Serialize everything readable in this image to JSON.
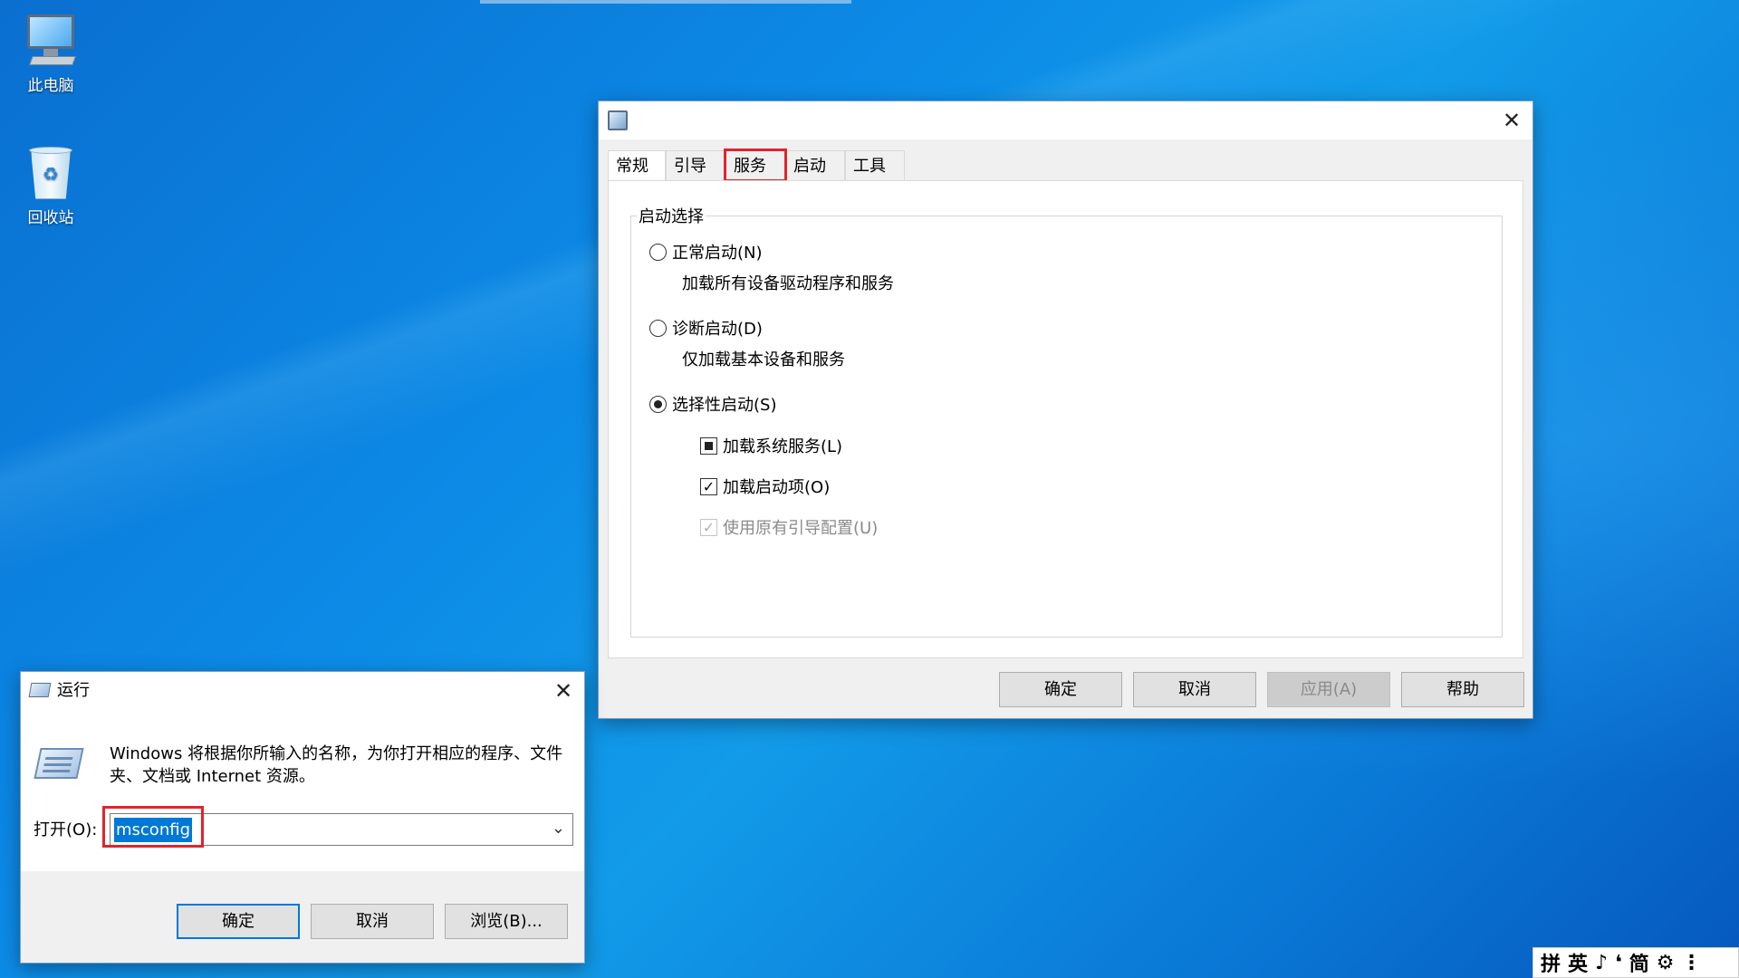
{
  "desktop": {
    "icons": [
      {
        "label": "此电脑",
        "icon": "computer-icon"
      },
      {
        "label": "回收站",
        "icon": "recycle-bin-icon"
      }
    ]
  },
  "msconfig": {
    "tabs": [
      "常规",
      "引导",
      "服务",
      "启动",
      "工具"
    ],
    "active_tab": "常规",
    "highlighted_tab": "服务",
    "group_title": "启动选择",
    "options": {
      "normal": {
        "label": "正常启动(N)",
        "desc": "加载所有设备驱动程序和服务"
      },
      "diagnostic": {
        "label": "诊断启动(D)",
        "desc": "仅加载基本设备和服务"
      },
      "selective": {
        "label": "选择性启动(S)"
      }
    },
    "checks": {
      "system_services": "加载系统服务(L)",
      "startup_items": "加载启动项(O)",
      "original_boot": "使用原有引导配置(U)"
    },
    "buttons": {
      "ok": "确定",
      "cancel": "取消",
      "apply": "应用(A)",
      "help": "帮助"
    }
  },
  "run": {
    "title": "运行",
    "description": "Windows 将根据你所输入的名称，为你打开相应的程序、文件夹、文档或 Internet 资源。",
    "open_label": "打开(O):",
    "input_value": "msconfig",
    "buttons": {
      "ok": "确定",
      "cancel": "取消",
      "browse": "浏览(B)..."
    }
  },
  "ime": {
    "items": [
      "拼",
      "英",
      "♪",
      "❛",
      "简",
      "⚙",
      "⋮"
    ]
  }
}
